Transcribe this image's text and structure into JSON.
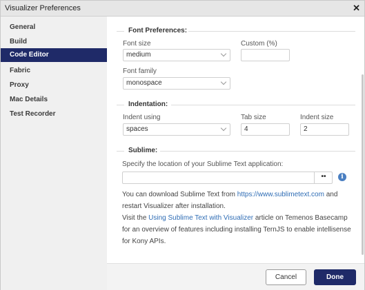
{
  "window": {
    "title": "Visualizer Preferences",
    "close_glyph": "✕"
  },
  "sidebar": {
    "items": [
      {
        "label": "General"
      },
      {
        "label": "Build"
      },
      {
        "label": "Code Editor",
        "active": true
      },
      {
        "label": "Fabric"
      },
      {
        "label": "Proxy"
      },
      {
        "label": "Mac Details"
      },
      {
        "label": "Test Recorder"
      }
    ]
  },
  "font_prefs": {
    "title": "Font Preferences:",
    "font_size_label": "Font size",
    "font_size_value": "medium",
    "custom_label": "Custom (%)",
    "custom_value": "",
    "font_family_label": "Font family",
    "font_family_value": "monospace"
  },
  "indentation": {
    "title": "Indentation:",
    "indent_using_label": "Indent using",
    "indent_using_value": "spaces",
    "tab_size_label": "Tab size",
    "tab_size_value": "4",
    "indent_size_label": "Indent size",
    "indent_size_value": "2"
  },
  "sublime": {
    "title": "Sublime:",
    "location_label": "Specify the location of your Sublime Text application:",
    "location_value": "",
    "browse_label": "••",
    "info_glyph": "i",
    "p1_a": "You can download Sublime Text from ",
    "p1_link": "https://www.sublimetext.com",
    "p1_b": " and",
    "p2": "restart Visualizer after installation.",
    "p3_a": "Visit the ",
    "p3_link": "Using Sublime Text with Visualizer",
    "p3_b": " article on Temenos Basecamp",
    "p4": "for an overview of features including installing TernJS to enable intellisense",
    "p5": "for Kony APIs."
  },
  "footer": {
    "cancel_label": "Cancel",
    "done_label": "Done"
  },
  "colors": {
    "accent": "#1f2a68",
    "link": "#2f6db5",
    "sidebar_bg": "#f0f0f0"
  }
}
